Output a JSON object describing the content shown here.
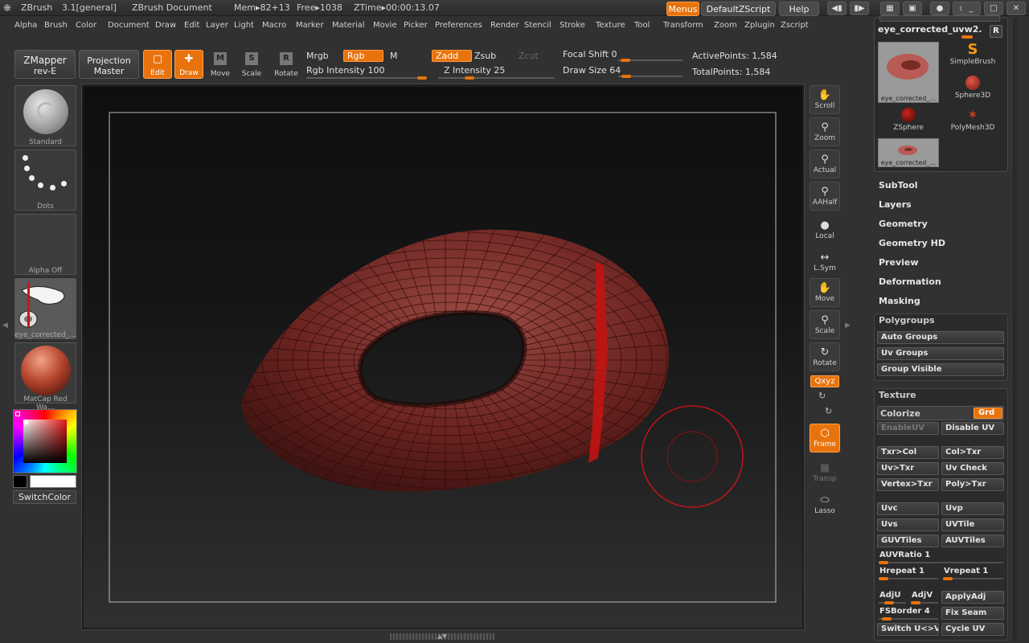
{
  "titlebar": {
    "app": "ZBrush",
    "version": "3.1[general]",
    "document": "ZBrush Document",
    "mem": "Mem▸82+13",
    "free": "Free▸1038",
    "ztime": "ZTime▸00:00:13.07",
    "menus_label": "Menus",
    "script_label": "DefaultZScript",
    "help_label": "Help"
  },
  "menubar": {
    "items": [
      "Alpha",
      "Brush",
      "Color",
      "Document",
      "Draw",
      "Edit",
      "Layer",
      "Light",
      "Macro",
      "Marker",
      "Material",
      "Movie",
      "Picker",
      "Preferences",
      "Render",
      "Stencil",
      "Stroke",
      "Texture",
      "Tool",
      "Transform",
      "Zoom",
      "Zplugin",
      "Zscript"
    ]
  },
  "shelf": {
    "zmapper": "ZMapper",
    "zmapper_sub": "rev-E",
    "projection": "Projection",
    "projection_sub": "Master",
    "edit": "Edit",
    "draw": "Draw",
    "move": "Move",
    "scale": "Scale",
    "rotate": "Rotate",
    "mrgb": "Mrgb",
    "rgb": "Rgb",
    "m": "M",
    "rgb_intensity": "Rgb Intensity 100",
    "zadd": "Zadd",
    "zsub": "Zsub",
    "zcut": "Zcut",
    "z_intensity": "Z Intensity 25",
    "focal_shift": "Focal Shift 0",
    "draw_size": "Draw Size 64",
    "active_points": "ActivePoints: 1,584",
    "total_points": "TotalPoints: 1,584",
    "rgb_intensity_value": 100,
    "z_intensity_value": 25,
    "focal_shift_value": 0,
    "draw_size_value": 64
  },
  "left_panel": {
    "brush_label": "Standard",
    "stroke_label": "Dots",
    "alpha_label": "Alpha Off",
    "texture_label": "eye_corrected_…",
    "material_label": "MatCap Red Wa…",
    "switch_color": "SwitchColor"
  },
  "right_toolbar": {
    "scroll": "Scroll",
    "zoom": "Zoom",
    "actual": "Actual",
    "aahalf": "AAHalf",
    "local": "Local",
    "lsym": "L.Sym",
    "move": "Move",
    "scale": "Scale",
    "rotate": "Rotate",
    "xyz": "Qxyz",
    "frame": "Frame",
    "transp": "Transp",
    "lasso": "Lasso"
  },
  "tool_panel": {
    "current_tool": "eye_corrected_uvw2.",
    "r_button": "R",
    "tools": [
      {
        "label": "eye_corrected_…"
      },
      {
        "label": "SimpleBrush"
      },
      {
        "label": "Sphere3D"
      },
      {
        "label": "ZSphere"
      },
      {
        "label": "PolyMesh3D"
      },
      {
        "label": "eye_corrected_…"
      }
    ]
  },
  "subpalettes": [
    "SubTool",
    "Layers",
    "Geometry",
    "Geometry HD",
    "Preview",
    "Deformation",
    "Masking"
  ],
  "polygroups": {
    "title": "Polygroups",
    "buttons": [
      "Auto Groups",
      "Uv Groups",
      "Group Visible"
    ]
  },
  "texture_panel": {
    "title": "Texture",
    "colorize": "Colorize",
    "grd": "Grd",
    "enable_uv": "EnableUV",
    "disable_uv": "Disable UV",
    "txr_col": "Txr>Col",
    "col_txr": "Col>Txr",
    "uv_txr": "Uv>Txr",
    "uv_check": "Uv Check",
    "vertex_txr": "Vertex>Txr",
    "poly_txr": "Poly>Txr",
    "uvc": "Uvc",
    "uvp": "Uvp",
    "uvs": "Uvs",
    "uvtile": "UVTile",
    "guvtiles": "GUVTiles",
    "auvtiles": "AUVTiles",
    "auvratio": "AUVRatio 1",
    "hrepeat": "Hrepeat 1",
    "vrepeat": "Vrepeat 1",
    "adju": "AdjU",
    "adjv": "AdjV",
    "applyadj": "ApplyAdj",
    "fsborder": "FSBorder 4",
    "fix_seam": "Fix Seam",
    "switch_uv": "Switch U<>V",
    "cycle_uv": "Cycle UV"
  },
  "colors": {
    "accent": "#e8730c",
    "mesh": "#7a2a24",
    "wire": "#3a0f0c",
    "brush_ring": "#c0141a"
  }
}
